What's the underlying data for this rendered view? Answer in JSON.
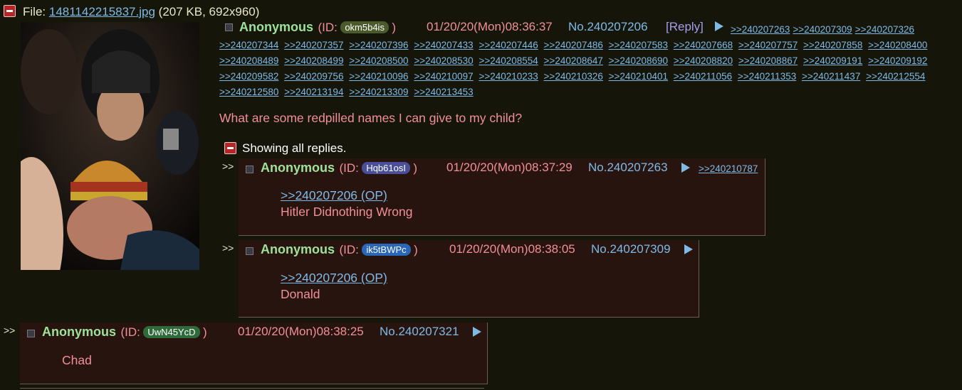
{
  "op": {
    "file_label": "File:",
    "file_name": "1481142215837.jpg",
    "file_info": "(207 KB, 692x960)",
    "name": "Anonymous",
    "id_prefix": "(ID:",
    "id_value": "okm5b4is",
    "id_suffix": ")",
    "id_color": "#4b5a2a",
    "datetime": "01/20/20(Mon)08:36:37",
    "post_no": "No.240207206",
    "reply_label": "[Reply]",
    "backlinks": [
      ">>240207263",
      ">>240207309",
      ">>240207326",
      ">>240207344",
      ">>240207357",
      ">>240207396",
      ">>240207433",
      ">>240207446",
      ">>240207486",
      ">>240207583",
      ">>240207668",
      ">>240207757",
      ">>240207858",
      ">>240208400",
      ">>240208489",
      ">>240208499",
      ">>240208500",
      ">>240208530",
      ">>240208554",
      ">>240208647",
      ">>240208690",
      ">>240208820",
      ">>240208867",
      ">>240209191",
      ">>240209192",
      ">>240209582",
      ">>240209756",
      ">>240210096",
      ">>240210097",
      ">>240210233",
      ">>240210326",
      ">>240210401",
      ">>240211056",
      ">>240211353",
      ">>240211437",
      ">>240212554",
      ">>240212580",
      ">>240213194",
      ">>240213309",
      ">>240213453"
    ],
    "comment": "What are some redpilled names I can give to my child?"
  },
  "showing_label": "Showing all replies.",
  "replies": [
    {
      "arrows": ">>",
      "name": "Anonymous",
      "id_value": "Hqb61osI",
      "id_color": "#4a4f9a",
      "datetime": "01/20/20(Mon)08:37:29",
      "post_no": "No.240207263",
      "backlink": ">>240210787",
      "quote": ">>240207206 (OP)",
      "text": "Hitler Didnothing Wrong"
    },
    {
      "arrows": ">>",
      "name": "Anonymous",
      "id_value": "ik5tBWPc",
      "id_color": "#2a67b8",
      "datetime": "01/20/20(Mon)08:38:05",
      "post_no": "No.240207309",
      "quote": ">>240207206 (OP)",
      "text": "Donald"
    },
    {
      "arrows": ">>",
      "name": "Anonymous",
      "id_value": "UwN45YcD",
      "id_color": "#2f6a3a",
      "datetime": "01/20/20(Mon)08:38:25",
      "post_no": "No.240207321",
      "text": "Chad"
    }
  ],
  "id_prefix": "(ID:",
  "id_suffix": ")"
}
